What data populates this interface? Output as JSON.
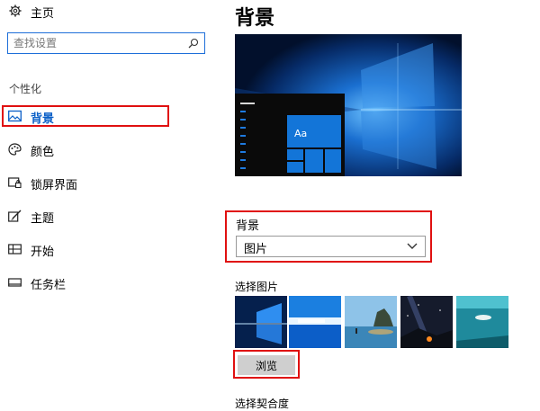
{
  "sidebar": {
    "home_label": "主页",
    "search_placeholder": "查找设置",
    "section_title": "个性化",
    "items": [
      {
        "label": "背景",
        "icon": "picture-icon",
        "active": true
      },
      {
        "label": "颜色",
        "icon": "palette-icon",
        "active": false
      },
      {
        "label": "锁屏界面",
        "icon": "lock-screen-icon",
        "active": false
      },
      {
        "label": "主题",
        "icon": "theme-brush-icon",
        "active": false
      },
      {
        "label": "开始",
        "icon": "start-menu-icon",
        "active": false
      },
      {
        "label": "任务栏",
        "icon": "taskbar-icon",
        "active": false
      }
    ]
  },
  "main": {
    "title": "背景",
    "preview_tile_text": "Aa",
    "background_label": "背景",
    "background_value": "图片",
    "choose_picture_label": "选择图片",
    "browse_label": "浏览",
    "choose_fit_label": "选择契合度"
  },
  "colors": {
    "accent": "#0a5fc7",
    "highlight_border": "#e01010",
    "tile_blue": "#1375d8"
  }
}
